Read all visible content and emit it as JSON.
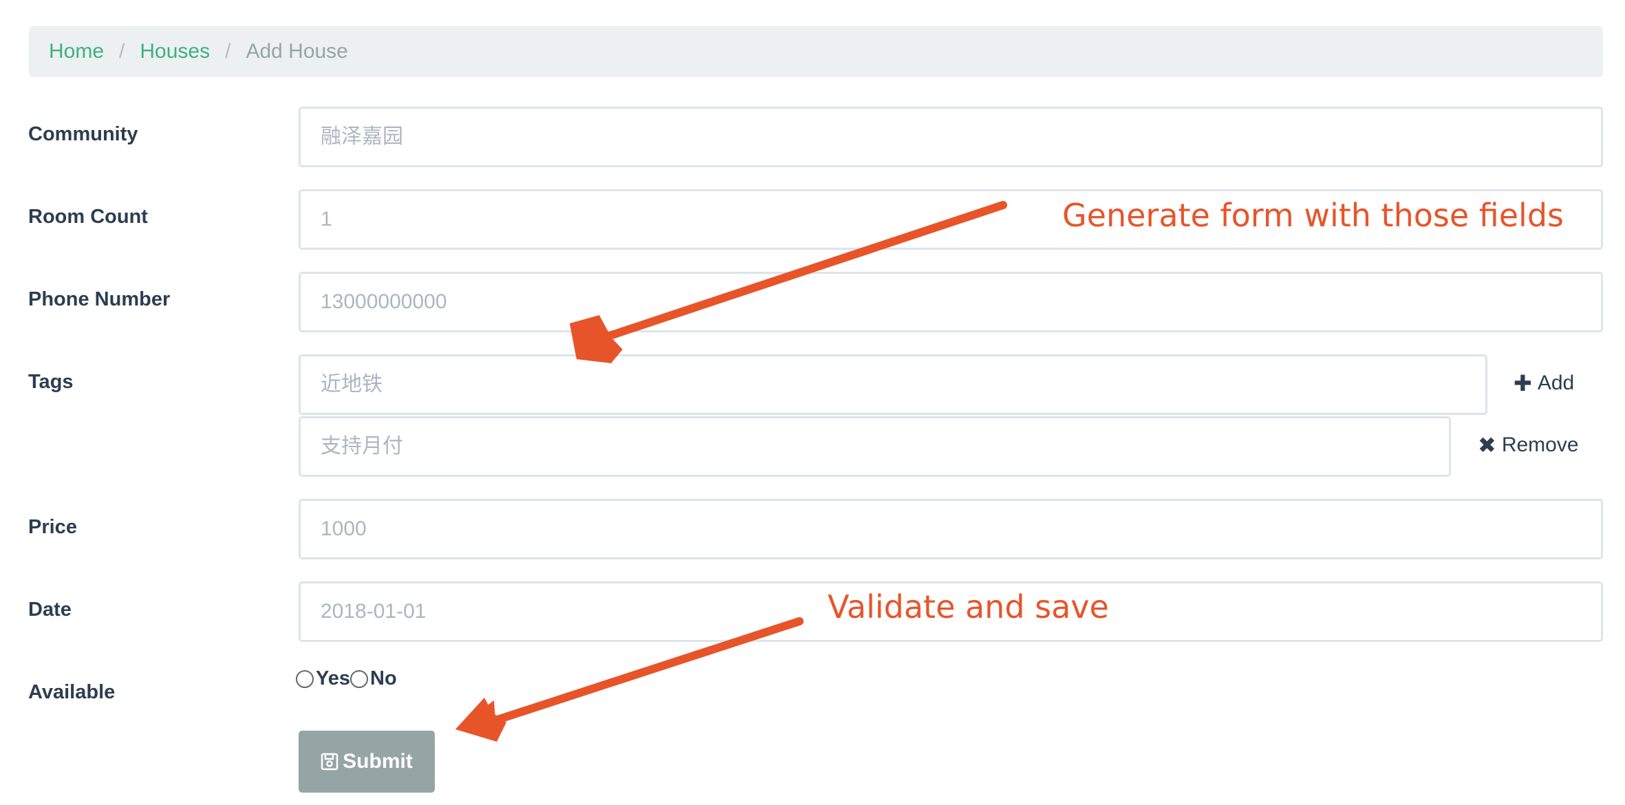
{
  "breadcrumb": {
    "home": "Home",
    "houses": "Houses",
    "current": "Add House",
    "separator": "/"
  },
  "form": {
    "community": {
      "label": "Community",
      "placeholder": "融泽嘉园"
    },
    "room_count": {
      "label": "Room Count",
      "placeholder": "1"
    },
    "phone": {
      "label": "Phone Number",
      "placeholder": "13000000000"
    },
    "tags": {
      "label": "Tags",
      "items": [
        {
          "placeholder": "近地铁"
        },
        {
          "placeholder": "支持月付"
        }
      ],
      "add_label": "Add",
      "remove_label": "Remove"
    },
    "price": {
      "label": "Price",
      "placeholder": "1000"
    },
    "date": {
      "label": "Date",
      "placeholder": "2018-01-01"
    },
    "available": {
      "label": "Available",
      "options": [
        "Yes",
        "No"
      ]
    },
    "submit_label": "Submit"
  },
  "annotations": {
    "generate": "Generate form with those fields",
    "validate": "Validate and save",
    "color": "#e8542a"
  },
  "colors": {
    "link": "#3fb07f",
    "button": "#95a5a6",
    "breadcrumb_bg": "#ecf0f1"
  }
}
